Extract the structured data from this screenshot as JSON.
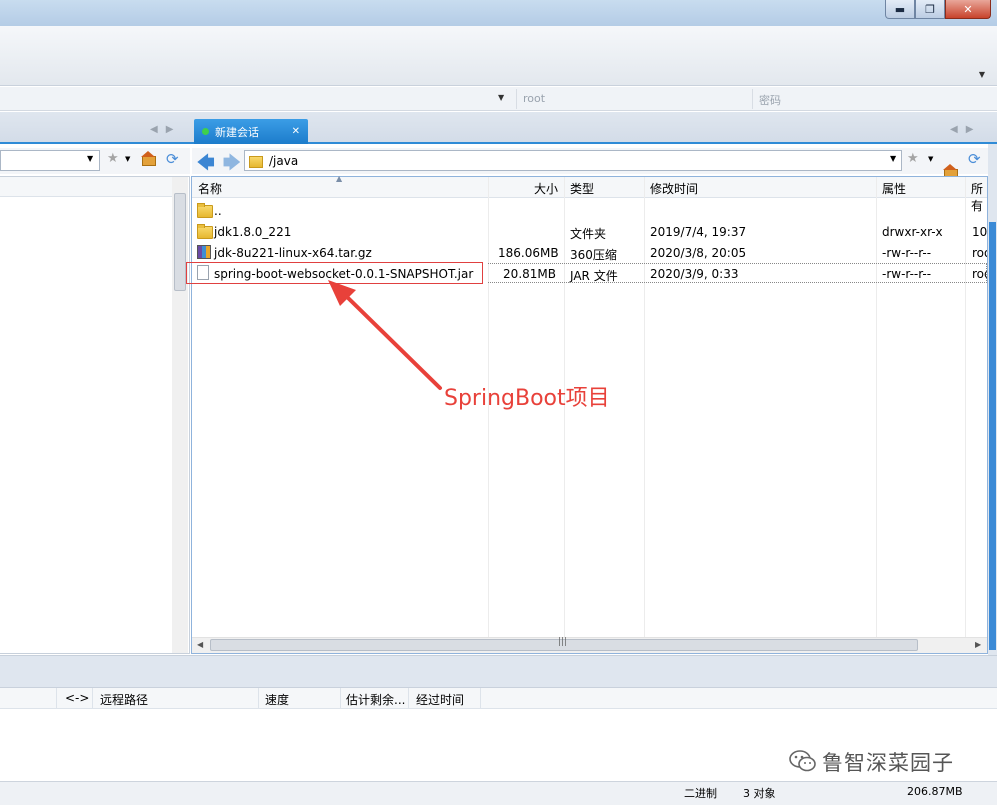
{
  "window": {
    "controls": {
      "minimize": "▬",
      "maximize": "❐",
      "close": "✕"
    }
  },
  "connection": {
    "username_placeholder": "root",
    "password_placeholder": "密码"
  },
  "tabs": [
    {
      "label": "新建会话",
      "close": "✕",
      "active": true,
      "status_color": "#3fd04b"
    }
  ],
  "remote": {
    "path": "/java",
    "columns": {
      "name": "名称",
      "size": "大小",
      "type": "类型",
      "modified": "修改时间",
      "attrs": "属性",
      "owner": "所有"
    },
    "files": [
      {
        "icon": "folder-icon",
        "name": "..",
        "size": "",
        "type": "",
        "modified": "",
        "attrs": "",
        "owner": ""
      },
      {
        "icon": "folder-icon",
        "name": "jdk1.8.0_221",
        "size": "",
        "type": "文件夹",
        "modified": "2019/7/4, 19:37",
        "attrs": "drwxr-xr-x",
        "owner": "10"
      },
      {
        "icon": "archive-icon",
        "name": "jdk-8u221-linux-x64.tar.gz",
        "size": "186.06MB",
        "type": "360压缩",
        "modified": "2020/3/8, 20:05",
        "attrs": "-rw-r--r--",
        "owner": "roo"
      },
      {
        "icon": "file-icon",
        "name": "spring-boot-websocket-0.0.1-SNAPSHOT.jar",
        "size": "20.81MB",
        "type": "JAR 文件",
        "modified": "2020/3/9, 0:33",
        "attrs": "-rw-r--r--",
        "owner": "roo"
      }
    ]
  },
  "annotation": {
    "text": "SpringBoot项目",
    "color": "#e8413a"
  },
  "transfer": {
    "columns": {
      "direction": "<->",
      "remote_path": "远程路径",
      "speed": "速度",
      "eta": "估计剩余...",
      "elapsed": "经过时间"
    }
  },
  "watermark": "鲁智深菜园子",
  "status": {
    "mode": "二进制",
    "objects": "3 对象",
    "size": "206.87MB"
  },
  "colors": {
    "accent": "#2f8bd6",
    "highlight": "#e04040"
  }
}
